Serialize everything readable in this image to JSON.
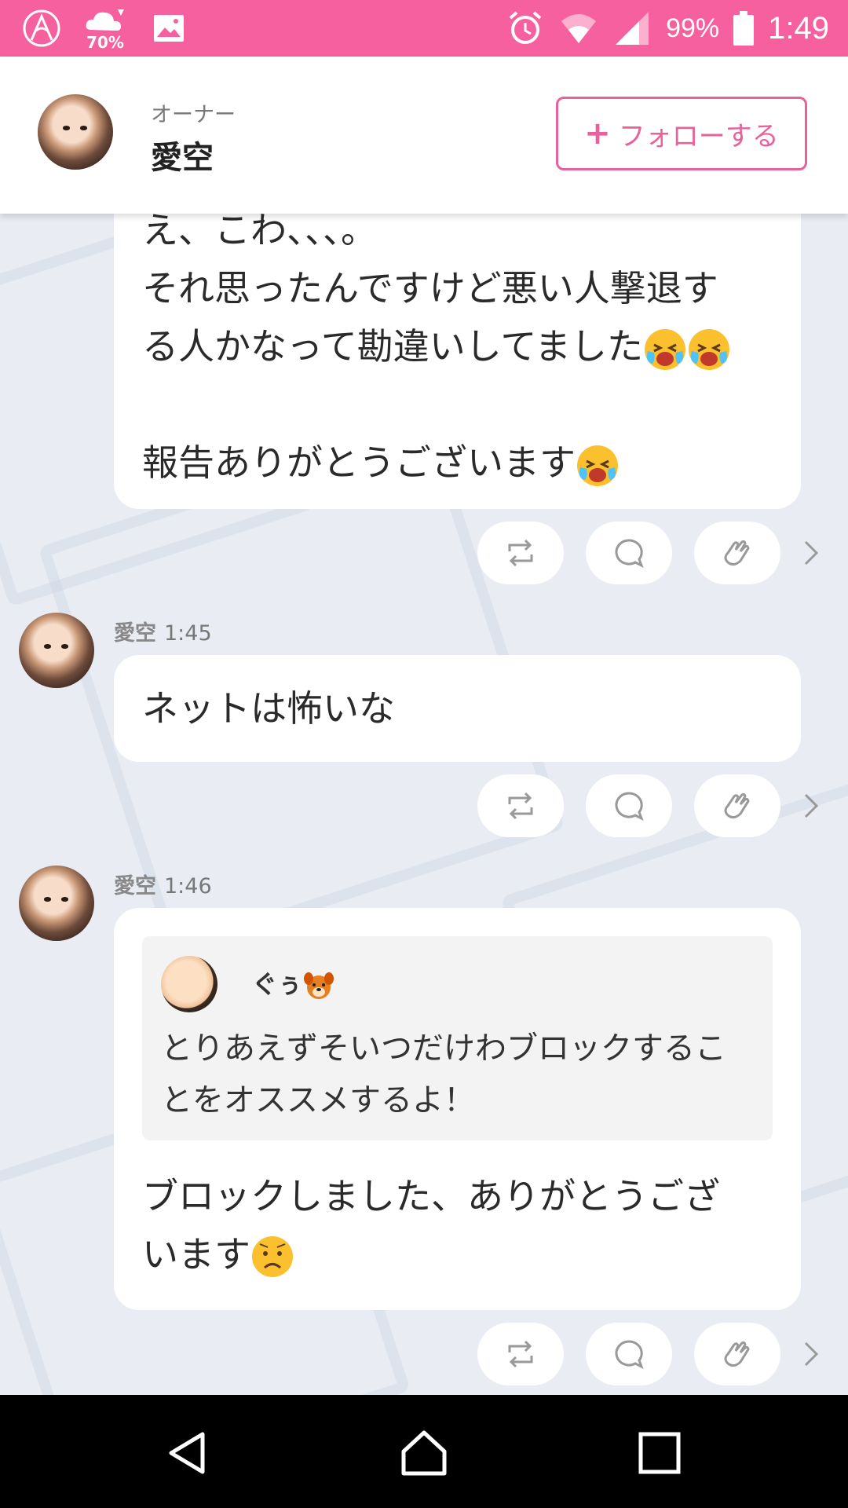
{
  "status_bar": {
    "weather_percent": "70%",
    "battery_percent": "99%",
    "time": "1:49",
    "background_color": "#f7609e"
  },
  "header": {
    "owner_label": "オーナー",
    "owner_name": "愛空",
    "follow_button": "フォローする",
    "follow_color": "#e8619a"
  },
  "messages": [
    {
      "lines_before": "え、こわ、、、。\nそれ思ったんですけど悪い人撃退す\nる人かなって勘違いしてました",
      "line_after": "報告ありがとうございます"
    },
    {
      "name": "愛空",
      "time": "1:45",
      "text": "ネットは怖いな"
    },
    {
      "name": "愛空",
      "time": "1:46",
      "quote": {
        "name": "ぐぅ",
        "text": "とりあえずそいつだけわブロックするこ\nとをオススメするよ！"
      },
      "text_before": "ブロックしました、ありがとうござ\nいます"
    }
  ],
  "icons": {
    "repost": "repost-icon",
    "comment": "comment-icon",
    "clap": "clap-icon",
    "more": "chevron-right-icon"
  }
}
